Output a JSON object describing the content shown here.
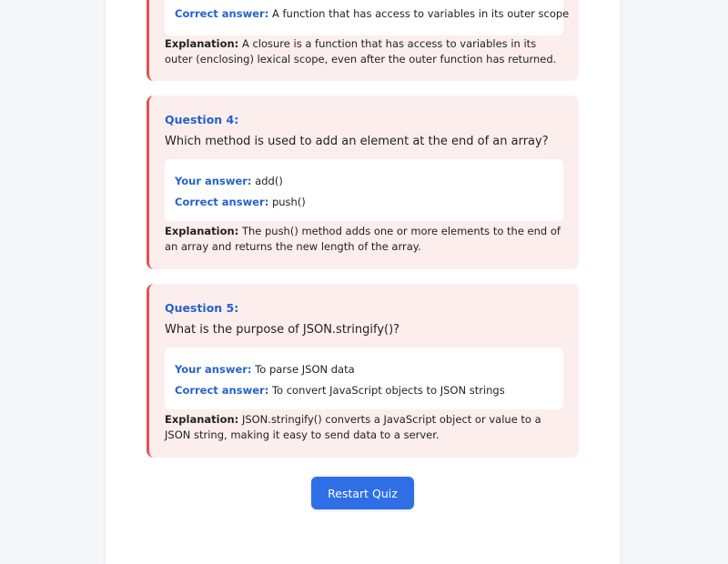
{
  "colors": {
    "accent": "#2563c9",
    "card_bg": "#fdeeee",
    "card_border": "#e05252",
    "button_bg": "#2f6fe6"
  },
  "labels": {
    "your_answer": "Your answer:",
    "correct_answer": "Correct answer:",
    "explanation": "Explanation:"
  },
  "questions": [
    {
      "correct_answer": "A function that has access to variables in its outer scope",
      "explanation": "A closure is a function that has access to variables in its outer (enclosing) lexical scope, even after the outer function has returned."
    },
    {
      "label": "Question 4:",
      "text": "Which method is used to add an element at the end of an array?",
      "your_answer": "add()",
      "correct_answer": "push()",
      "explanation": "The push() method adds one or more elements to the end of an array and returns the new length of the array."
    },
    {
      "label": "Question 5:",
      "text": "What is the purpose of JSON.stringify()?",
      "your_answer": "To parse JSON data",
      "correct_answer": "To convert JavaScript objects to JSON strings",
      "explanation": "JSON.stringify() converts a JavaScript object or value to a JSON string, making it easy to send data to a server."
    }
  ],
  "restart_label": "Restart Quiz"
}
